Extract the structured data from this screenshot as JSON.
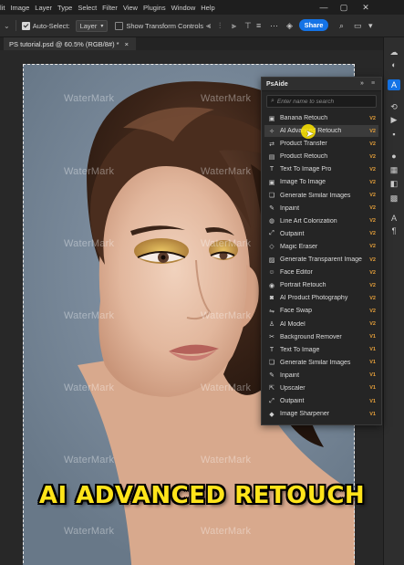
{
  "menubar": {
    "items": [
      "lit",
      "Image",
      "Layer",
      "Type",
      "Select",
      "Filter",
      "View",
      "Plugins",
      "Window",
      "Help"
    ],
    "minimize_icon": "minimize-icon",
    "maximize_icon": "maximize-icon",
    "close_icon": "close-icon"
  },
  "options": {
    "auto_select_label": "Auto-Select:",
    "auto_select_checked": true,
    "auto_select_target": "Layer",
    "show_transform_label": "Show Transform Controls",
    "show_transform_checked": false,
    "share_label": "Share"
  },
  "document": {
    "tab_title": "PS tutorial.psd @ 60.5% (RGB/8#) *",
    "close_glyph": "×"
  },
  "watermark_text": "WaterMark",
  "panel": {
    "title": "PsAide",
    "search_placeholder": "Enter name to search",
    "items": [
      {
        "label": "Banana Retouch",
        "version": "V2",
        "icon": "image-icon"
      },
      {
        "label": "AI Advanced Retouch",
        "version": "V2",
        "icon": "magic-icon"
      },
      {
        "label": "Product Transfer",
        "version": "V2",
        "icon": "transfer-icon"
      },
      {
        "label": "Product Retouch",
        "version": "V2",
        "icon": "box-icon"
      },
      {
        "label": "Text To Image Pro",
        "version": "V2",
        "icon": "text-icon"
      },
      {
        "label": "Image To Image",
        "version": "V2",
        "icon": "image-icon"
      },
      {
        "label": "Generate Similar Images",
        "version": "V2",
        "icon": "layers-icon"
      },
      {
        "label": "Inpaint",
        "version": "V2",
        "icon": "brush-icon"
      },
      {
        "label": "Line Art Colorization",
        "version": "V2",
        "icon": "palette-icon"
      },
      {
        "label": "Outpaint",
        "version": "V2",
        "icon": "expand-icon"
      },
      {
        "label": "Magic Eraser",
        "version": "V2",
        "icon": "eraser-icon"
      },
      {
        "label": "Generate Transparent Image",
        "version": "V2",
        "icon": "transparent-icon"
      },
      {
        "label": "Face Editor",
        "version": "V2",
        "icon": "face-icon"
      },
      {
        "label": "Portrait Retouch",
        "version": "V2",
        "icon": "portrait-icon"
      },
      {
        "label": "AI Product Photography",
        "version": "V2",
        "icon": "camera-icon"
      },
      {
        "label": "Face Swap",
        "version": "V2",
        "icon": "swap-icon"
      },
      {
        "label": "AI Model",
        "version": "V2",
        "icon": "person-icon"
      },
      {
        "label": "Background Remover",
        "version": "V1",
        "icon": "scissors-icon"
      },
      {
        "label": "Text To Image",
        "version": "V1",
        "icon": "text-icon"
      },
      {
        "label": "Generate Similar Images",
        "version": "V1",
        "icon": "layers-icon"
      },
      {
        "label": "Inpaint",
        "version": "V1",
        "icon": "brush-icon"
      },
      {
        "label": "Upscaler",
        "version": "V1",
        "icon": "upscale-icon"
      },
      {
        "label": "Outpaint",
        "version": "V1",
        "icon": "expand-icon"
      },
      {
        "label": "Image Sharpener",
        "version": "V1",
        "icon": "sharpen-icon"
      }
    ]
  },
  "caption": "AI ADVANCED RETOUCH"
}
